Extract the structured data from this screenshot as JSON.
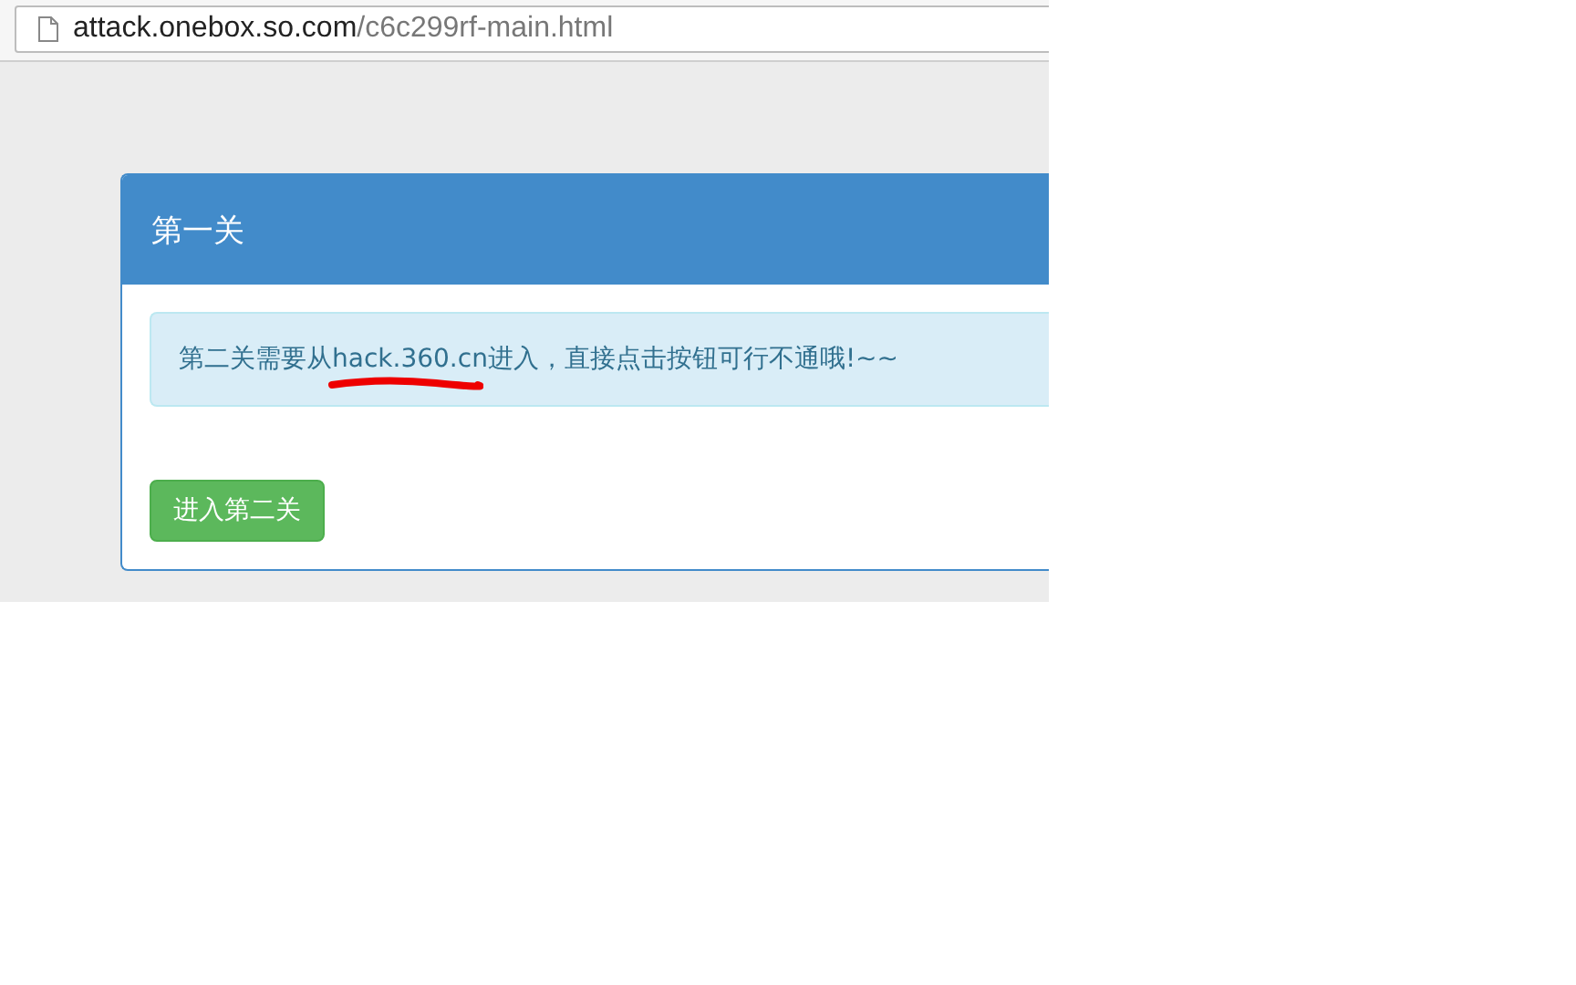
{
  "address_bar": {
    "host": "attack.onebox.so.com",
    "path": "/c6c299rf-main.html"
  },
  "panel": {
    "title": "第一关",
    "alert": "第二关需要从hack.360.cn进入，直接点击按钮可行不通哦!~~",
    "button": "进入第二关"
  }
}
